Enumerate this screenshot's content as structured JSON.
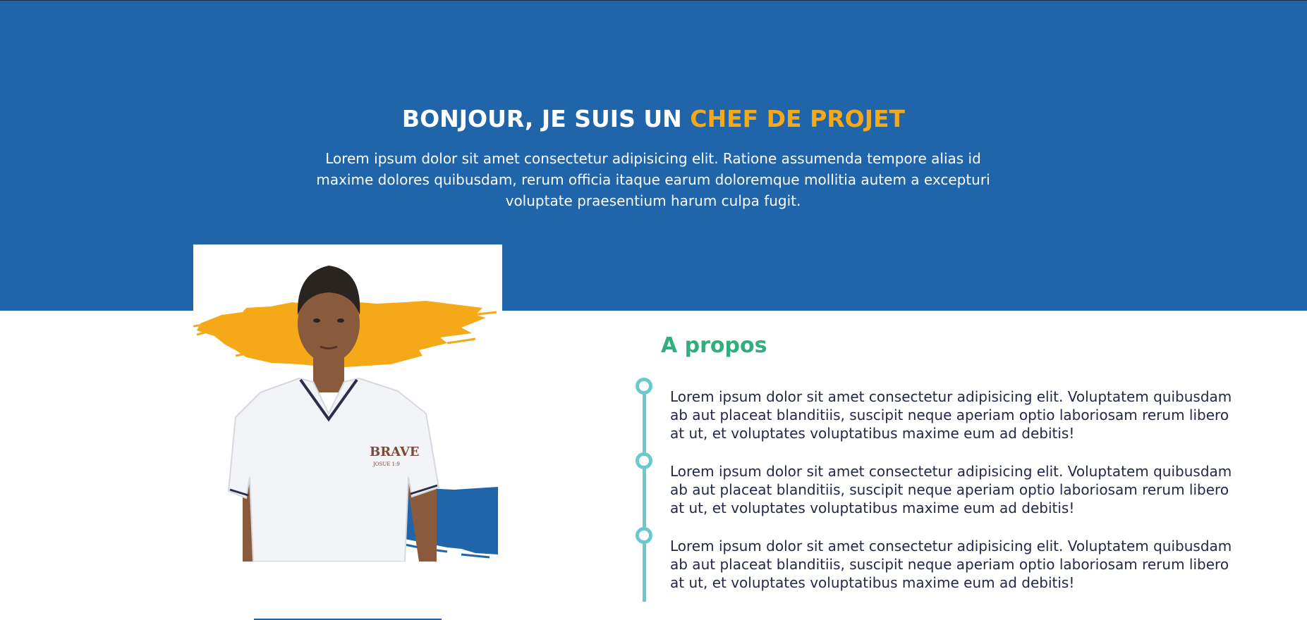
{
  "hero": {
    "title_prefix": "BONJOUR, JE SUIS UN ",
    "title_highlight": "CHEF DE PROJET",
    "intro_line1": "Lorem ipsum dolor sit amet consectetur adipisicing elit. Ratione assumenda tempore alias id",
    "intro_line2": "maxime dolores quibusdam, rerum officia itaque earum doloremque mollitia autem a excepturi",
    "intro_line3": "voluptate praesentium harum culpa fugit."
  },
  "photo": {
    "shirt_text": "BRAVE",
    "shirt_subtext": "JOSUE 1:9"
  },
  "about": {
    "title": "A propos",
    "items": [
      {
        "line1": "Lorem ipsum dolor sit amet consectetur adipisicing elit. Voluptatem quibusdam",
        "line2": "ab aut placeat blanditiis, suscipit neque aperiam optio laboriosam rerum libero",
        "line3": "at ut, et voluptates voluptatibus maxime eum ad debitis!"
      },
      {
        "line1": "Lorem ipsum dolor sit amet consectetur adipisicing elit. Voluptatem quibusdam",
        "line2": "ab aut placeat blanditiis, suscipit neque aperiam optio laboriosam rerum libero",
        "line3": "at ut, et voluptates voluptatibus maxime eum ad debitis!"
      },
      {
        "line1": "Lorem ipsum dolor sit amet consectetur adipisicing elit. Voluptatem quibusdam",
        "line2": "ab aut placeat blanditiis, suscipit neque aperiam optio laboriosam rerum libero",
        "line3": "at ut, et voluptates voluptatibus maxime eum ad debitis!"
      }
    ]
  },
  "colors": {
    "primary_blue": "#2065a9",
    "accent_orange": "#f5a818",
    "about_green": "#2fae7e",
    "timeline_teal": "#6cc9cb",
    "body_text": "#23284a"
  }
}
